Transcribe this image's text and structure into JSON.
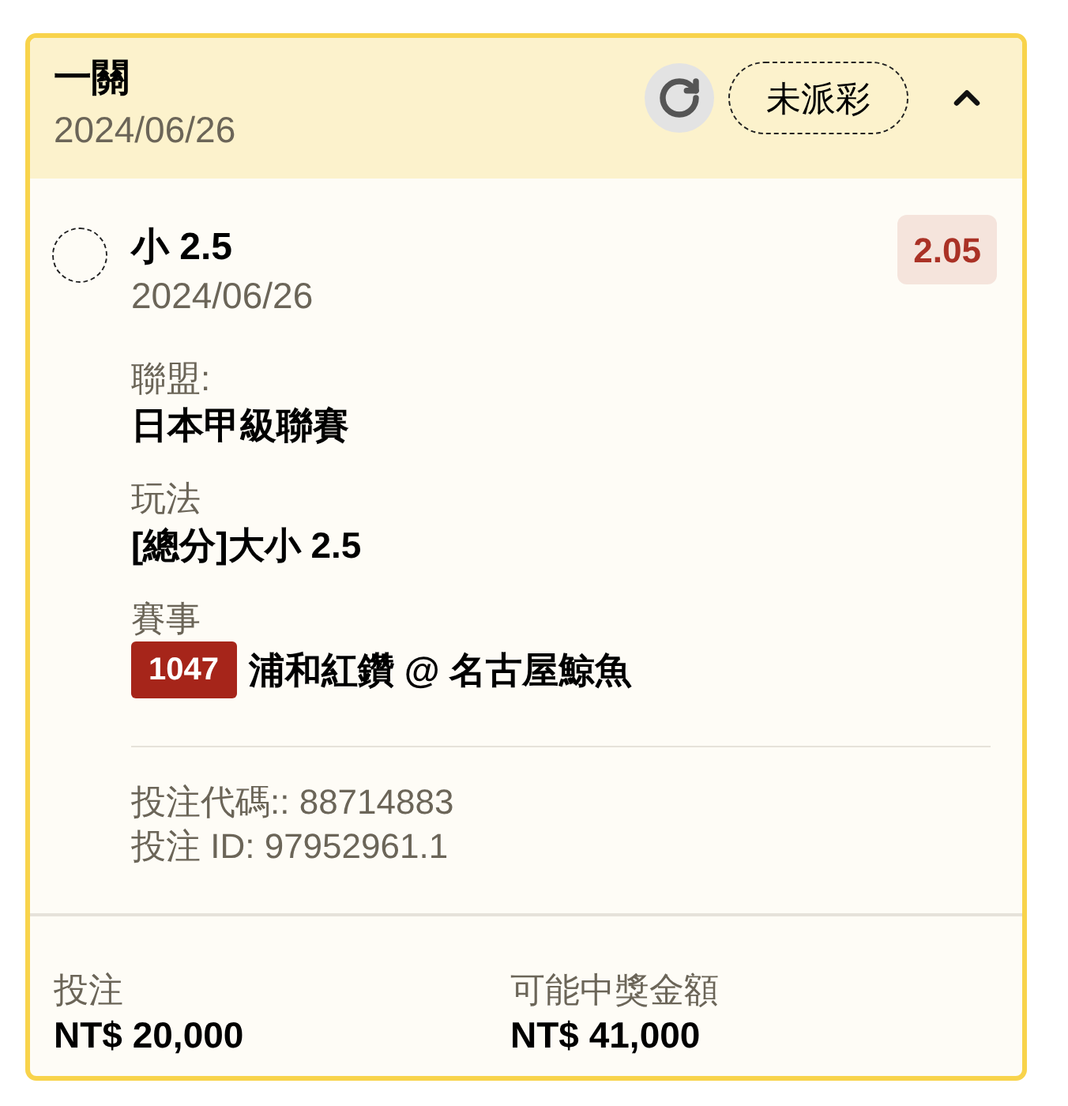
{
  "ticket": {
    "title": "一關",
    "date": "2024/06/26",
    "status": "未派彩",
    "expanded": true
  },
  "selection": {
    "name": "小 2.5",
    "date": "2024/06/26",
    "odds": "2.05"
  },
  "details": [
    {
      "label": "聯盟:",
      "value": "日本甲級聯賽"
    },
    {
      "label": "玩法",
      "value": "[總分]大小 2.5"
    },
    {
      "label": "賽事",
      "match_number": "1047",
      "value": "浦和紅鑽 @ 名古屋鯨魚"
    }
  ],
  "bet_info": [
    "投注代碼:: 88714883",
    "投注 ID: 97952961.1"
  ],
  "summary": [
    {
      "label": "投注",
      "value": "NT$ 20,000"
    },
    {
      "label": "可能中獎金額",
      "value": "NT$ 41,000"
    }
  ]
}
